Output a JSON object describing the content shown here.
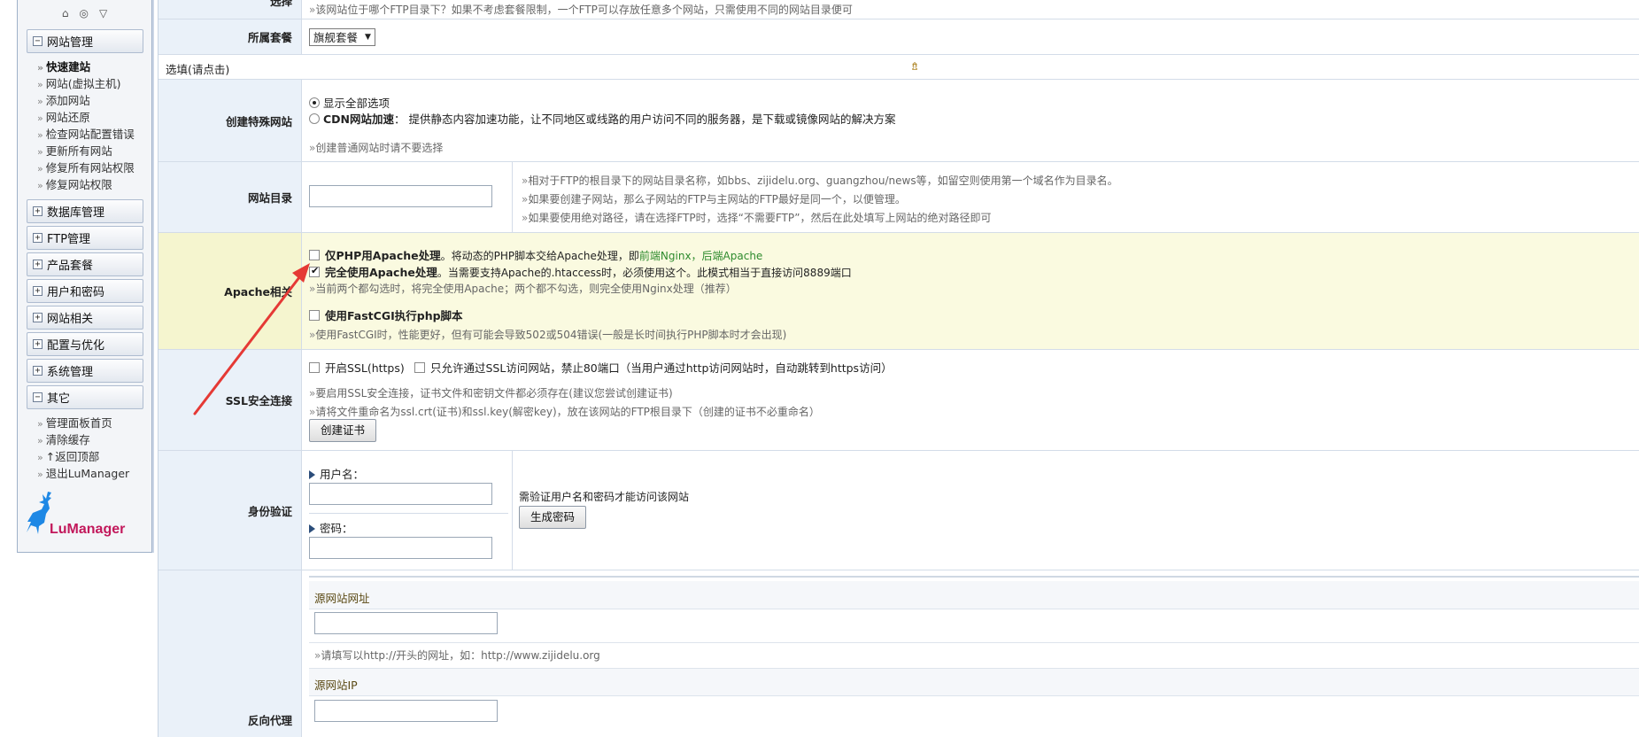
{
  "sidebar": {
    "top_icons": [
      "⌂",
      "◎",
      "▽"
    ],
    "menus": [
      {
        "label": "网站管理",
        "toggle": "−"
      },
      {
        "label": "数据库管理",
        "toggle": "+"
      },
      {
        "label": "FTP管理",
        "toggle": "+"
      },
      {
        "label": "产品套餐",
        "toggle": "+"
      },
      {
        "label": "用户和密码",
        "toggle": "+"
      },
      {
        "label": "网站相关",
        "toggle": "+"
      },
      {
        "label": "配置与优化",
        "toggle": "+"
      },
      {
        "label": "系统管理",
        "toggle": "+"
      },
      {
        "label": "其它",
        "toggle": "−"
      }
    ],
    "site_items": [
      "快速建站",
      "网站(虚拟主机)",
      "添加网站",
      "网站还原",
      "检查网站配置错误",
      "更新所有网站",
      "修复所有网站权限",
      "修复网站权限"
    ],
    "other_items": [
      "管理面板首页",
      "清除缓存",
      "↑返回顶部",
      "退出LuManager"
    ],
    "logo_text": "LuManager"
  },
  "rows": {
    "top_label": "选择",
    "top_hint": "该网站位于哪个FTP目录下？如果不考虑套餐限制，一个FTP可以存放任意多个网站，只需使用不同的网站目录便可",
    "package": {
      "label": "所属套餐",
      "selected": "旗舰套餐",
      "arrow": "▼"
    },
    "optional": {
      "text": "选填(请点击)",
      "icon": "⇯"
    },
    "special": {
      "label": "创建特殊网站",
      "opt_all": "显示全部选项",
      "opt_cdn_bold": "CDN网站加速",
      "opt_cdn_rest": "：  提供静态内容加速功能，让不同地区或线路的用户访问不同的服务器，是下载或镜像网站的解决方案",
      "hint": "创建普通网站时请不要选择"
    },
    "dir": {
      "label": "网站目录",
      "value": "",
      "hints": [
        "相对于FTP的根目录下的网站目录名称，如bbs、zijidelu.org、guangzhou/news等，如留空则使用第一个域名作为目录名。",
        "如果要创建子网站，那么子网站的FTP与主网站的FTP最好是同一个，以便管理。",
        "如果要使用绝对路径，请在选择FTP时，选择“不需要FTP”，然后在此处填写上网站的绝对路径即可"
      ]
    },
    "apache": {
      "label": "Apache相关",
      "opt1_bold": "仅PHP用Apache处理",
      "opt1_rest": "。将动态的PHP脚本交给Apache处理，即",
      "opt1_green": "前端Nginx，后端Apache",
      "opt2_bold": "完全使用Apache处理",
      "opt2_rest": "。当需要支持Apache的.htaccess时，必须使用这个。此模式相当于直接访问8889端口",
      "hint1": "当前两个都勾选时，将完全使用Apache；两个都不勾选，则完全使用Nginx处理（推荐）",
      "opt3_bold": "使用FastCGI执行php脚本",
      "hint2": "使用FastCGI时，性能更好，但有可能会导致502或504错误(一般是长时间执行PHP脚本时才会出现)"
    },
    "ssl": {
      "label": "SSL安全连接",
      "opt1": "开启SSL(https)",
      "opt2": "只允许通过SSL访问网站，禁止80端口（当用户通过http访问网站时，自动跳转到https访问）",
      "hint1": "要启用SSL安全连接，证书文件和密钥文件都必须存在(建议您尝试创建证书)",
      "hint2": "请将文件重命名为ssl.crt(证书)和ssl.key(解密key)，放在该网站的FTP根目录下（创建的证书不必重命名）",
      "button": "创建证书"
    },
    "auth": {
      "label": "身份验证",
      "user_label": "用户名：",
      "pass_label": "密码：",
      "note": "需验证用户名和密码才能访问该网站",
      "button": "生成密码"
    },
    "proxy": {
      "label": "反向代理",
      "src_url_label": "源网站网址",
      "src_url_hint": "请填写以http://开头的网址，如：http://www.zijidelu.org",
      "src_ip_label": "源网站IP"
    }
  },
  "colors": {
    "label_bg": "#eaf1f9",
    "apache_bg": "#fafae0",
    "annotation_arrow": "#e53935",
    "border": "#d3dce8"
  }
}
